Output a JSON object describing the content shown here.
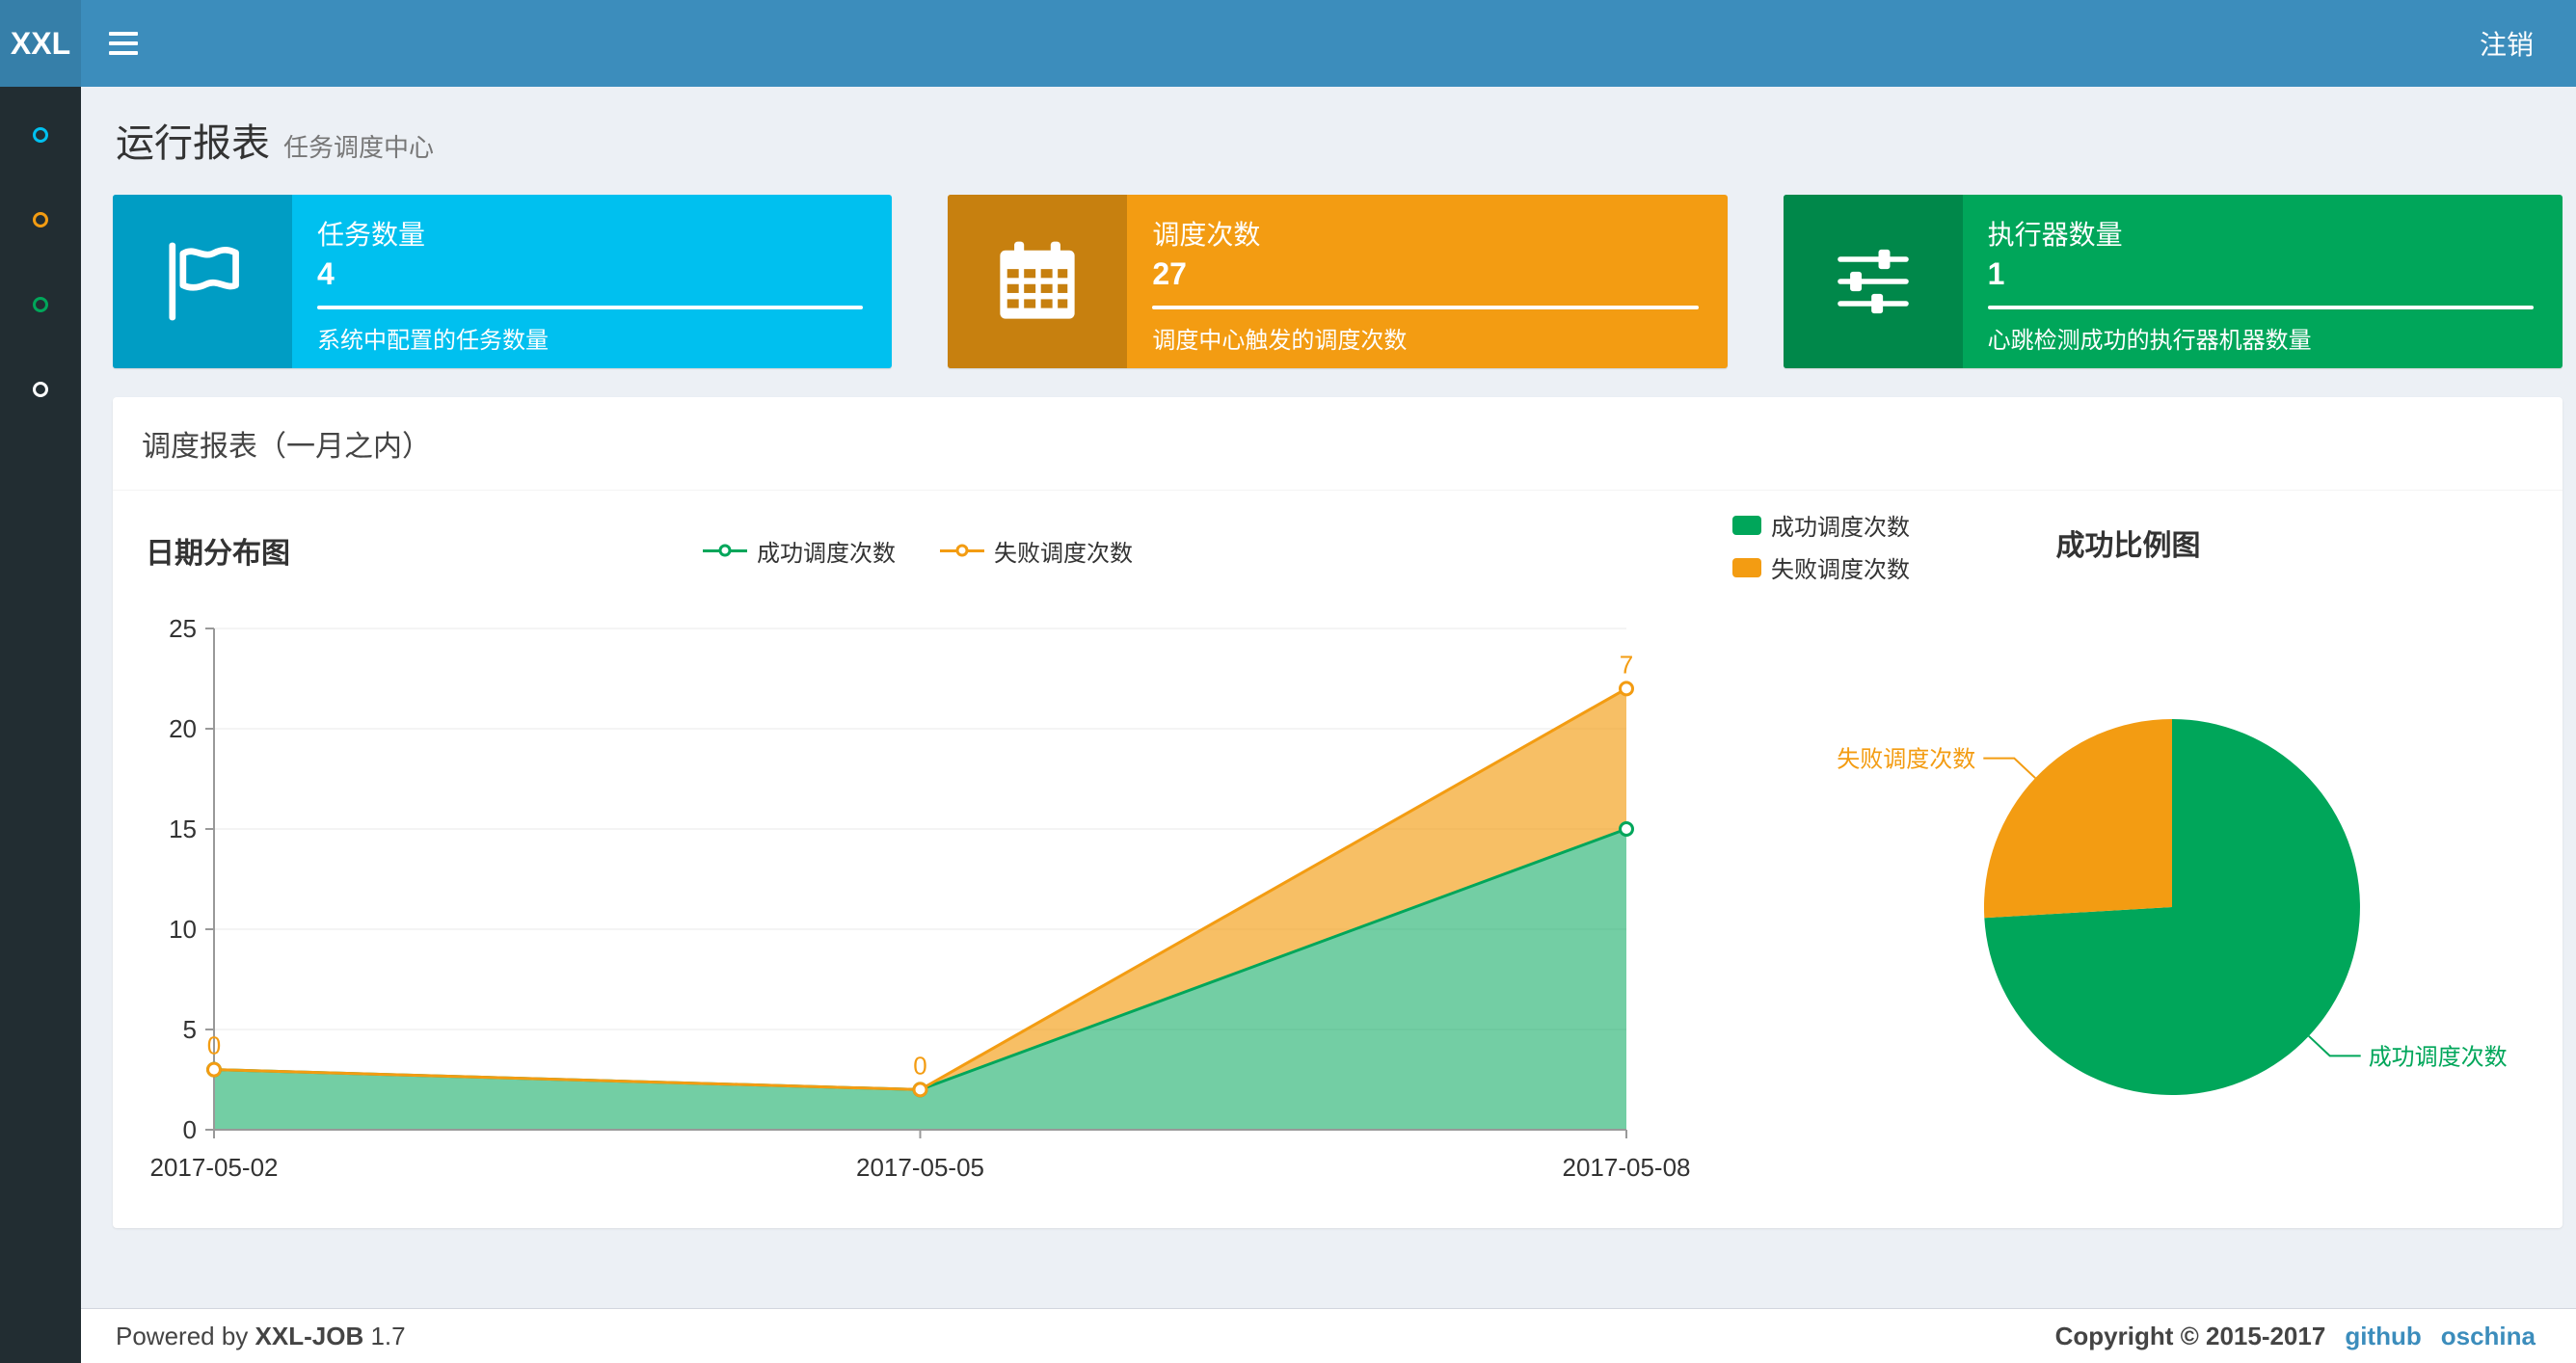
{
  "colors": {
    "navbar": "#3c8dbc",
    "logo_bg": "#367fa9",
    "sidebar_bg": "#222d32",
    "content_bg": "#ecf0f5",
    "link": "#3c8dbc"
  },
  "navbar": {
    "logo": "XXL",
    "logout_label": "注销"
  },
  "sidebar": {
    "items": [
      {
        "icon": "circle-icon",
        "color": "#00c0ef"
      },
      {
        "icon": "circle-icon",
        "color": "#f39c12"
      },
      {
        "icon": "circle-icon",
        "color": "#00a65a"
      },
      {
        "icon": "circle-icon",
        "color": "#ffffff"
      }
    ]
  },
  "page_header": {
    "title": "运行报表",
    "subtitle": "任务调度中心"
  },
  "info_boxes": [
    {
      "icon": "flag-icon",
      "color": "#00c0ef",
      "label": "任务数量",
      "value": "4",
      "description": "系统中配置的任务数量"
    },
    {
      "icon": "calendar-icon",
      "color": "#f39c12",
      "label": "调度次数",
      "value": "27",
      "description": "调度中心触发的调度次数"
    },
    {
      "icon": "sliders-icon",
      "color": "#00a65a",
      "label": "执行器数量",
      "value": "1",
      "description": "心跳检测成功的执行器机器数量"
    }
  ],
  "panel": {
    "title": "调度报表（一月之内）"
  },
  "chart_data": [
    {
      "type": "area",
      "title": "日期分布图",
      "x": [
        "2017-05-02",
        "2017-05-05",
        "2017-05-08"
      ],
      "series": [
        {
          "name": "成功调度次数",
          "color": "#00a65a",
          "values": [
            3,
            2,
            15
          ]
        },
        {
          "name": "失败调度次数",
          "color": "#f39c12",
          "values": [
            0,
            0,
            7
          ]
        }
      ],
      "stacked": true,
      "ylim": [
        0,
        25
      ],
      "yticks": [
        0,
        5,
        10,
        15,
        20,
        25
      ],
      "point_labels": [
        "0",
        "0",
        "7"
      ],
      "grid": true,
      "legend_position": "top-center"
    },
    {
      "type": "pie",
      "title": "成功比例图",
      "slices": [
        {
          "name": "成功调度次数",
          "value": 20,
          "color": "#00a65a"
        },
        {
          "name": "失败调度次数",
          "value": 7,
          "color": "#f39c12"
        }
      ],
      "legend_position": "top-left"
    }
  ],
  "footer": {
    "powered_by": "Powered by",
    "product": "XXL-JOB",
    "version": "1.7",
    "copyright": "Copyright © 2015-2017",
    "links": [
      {
        "label": "github"
      },
      {
        "label": "oschina"
      }
    ]
  }
}
